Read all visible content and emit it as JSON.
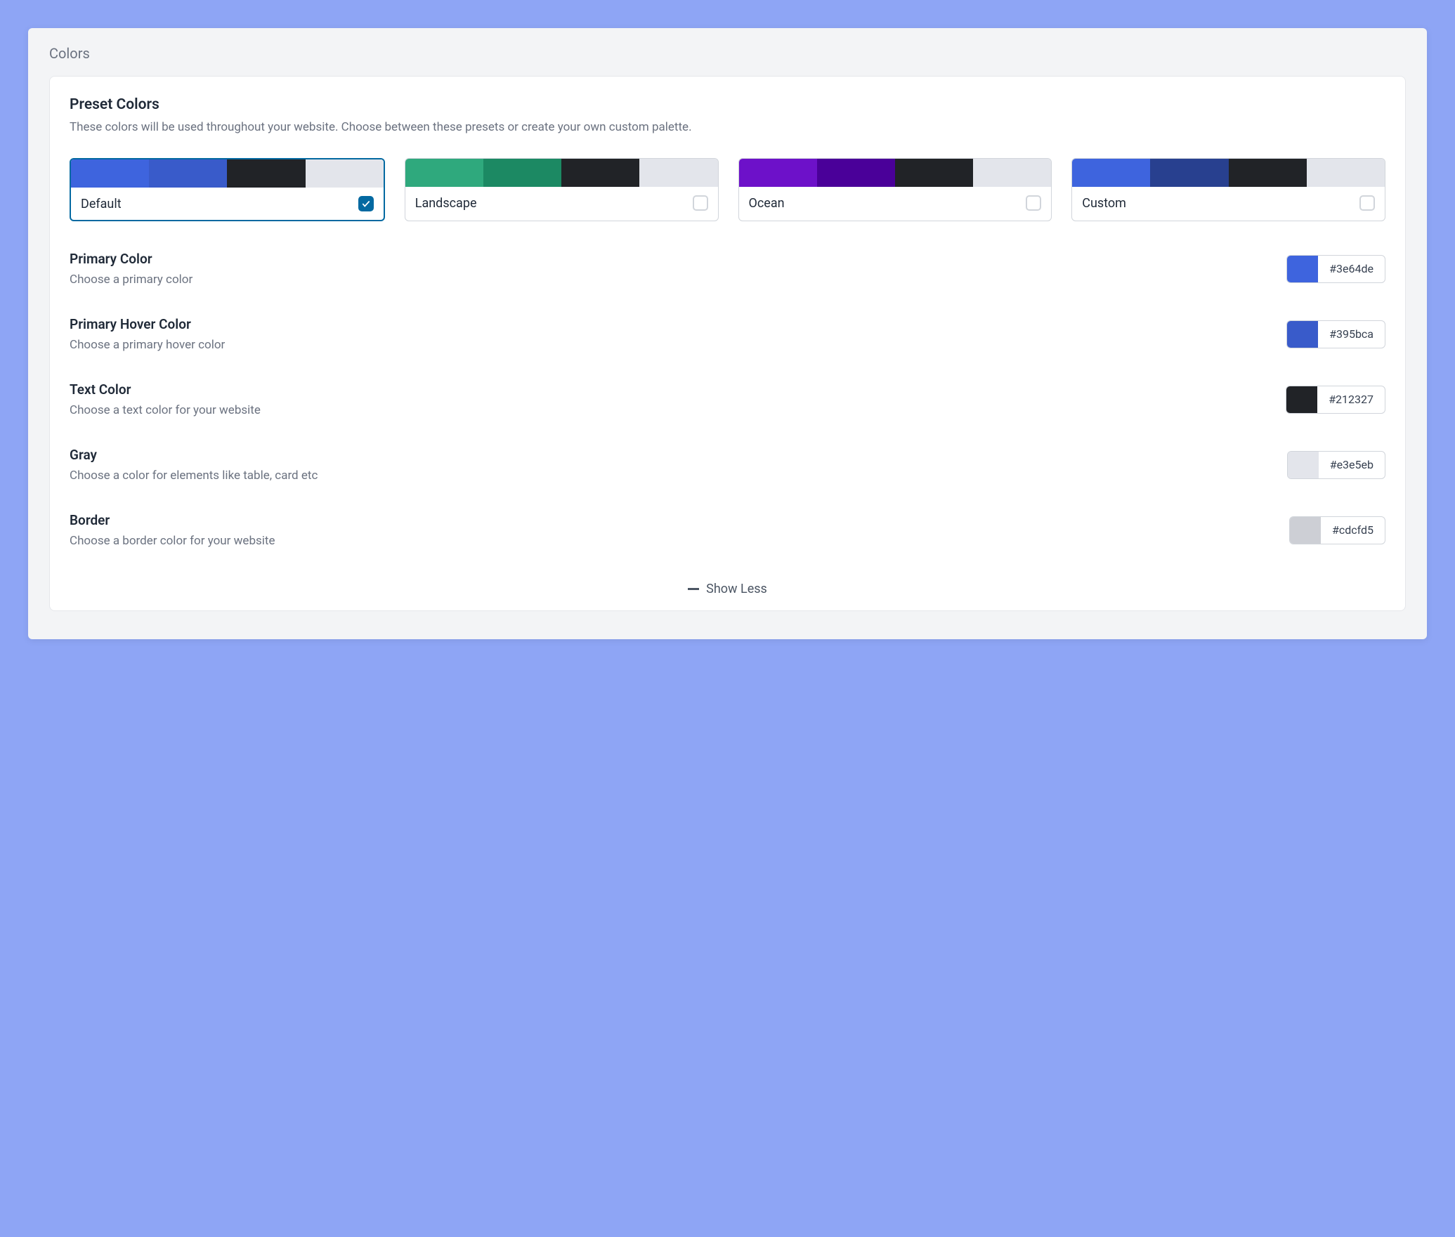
{
  "panel_title": "Colors",
  "section": {
    "title": "Preset Colors",
    "desc": "These colors will be used throughout your website. Choose between these presets or create your own custom palette."
  },
  "presets": [
    {
      "label": "Default",
      "selected": true,
      "swatches": [
        "#3e64de",
        "#395bca",
        "#212327",
        "#e3e5eb"
      ]
    },
    {
      "label": "Landscape",
      "selected": false,
      "swatches": [
        "#2fa97d",
        "#1c8963",
        "#212327",
        "#e3e5eb"
      ]
    },
    {
      "label": "Ocean",
      "selected": false,
      "swatches": [
        "#6d11c9",
        "#4a0099",
        "#212327",
        "#e3e5eb"
      ]
    },
    {
      "label": "Custom",
      "selected": false,
      "swatches": [
        "#3e64de",
        "#28408f",
        "#212327",
        "#e3e5eb"
      ]
    }
  ],
  "colors": [
    {
      "label": "Primary Color",
      "desc": "Choose a primary color",
      "value": "#3e64de"
    },
    {
      "label": "Primary Hover Color",
      "desc": "Choose a primary hover color",
      "value": "#395bca"
    },
    {
      "label": "Text Color",
      "desc": "Choose a text color for your website",
      "value": "#212327"
    },
    {
      "label": "Gray",
      "desc": "Choose a color for elements like table, card etc",
      "value": "#e3e5eb"
    },
    {
      "label": "Border",
      "desc": "Choose a border color for your website",
      "value": "#cdcfd5"
    }
  ],
  "show_less": "Show Less"
}
